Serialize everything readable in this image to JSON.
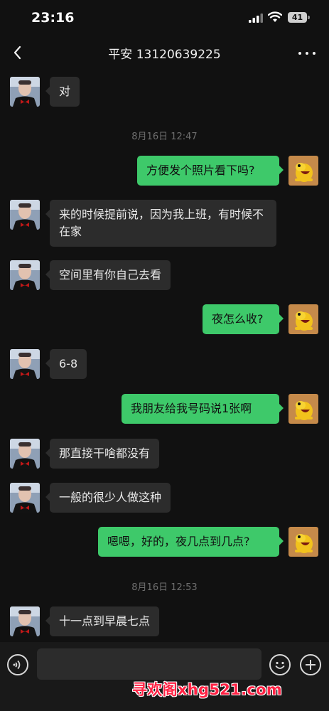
{
  "status_bar": {
    "time": "23:16",
    "battery": "41"
  },
  "header": {
    "title": "平安 13120639225"
  },
  "messages": [
    {
      "type": "in",
      "text": "对"
    },
    {
      "type": "time",
      "text": "8月16日 12:47"
    },
    {
      "type": "out",
      "text": "方便发个照片看下吗?"
    },
    {
      "type": "in",
      "text": "来的时候提前说，因为我上班，有时候不在家"
    },
    {
      "type": "in",
      "text": "空间里有你自己去看"
    },
    {
      "type": "out",
      "text": "夜怎么收?"
    },
    {
      "type": "in",
      "text": "6-8"
    },
    {
      "type": "out",
      "text": "我朋友给我号码说1张啊"
    },
    {
      "type": "in",
      "text": "那直接干啥都没有"
    },
    {
      "type": "in",
      "text": "一般的很少人做这种"
    },
    {
      "type": "out",
      "text": "嗯嗯，好的，夜几点到几点?"
    },
    {
      "type": "time",
      "text": "8月16日 12:53"
    },
    {
      "type": "in",
      "text": "十一点到早晨七点"
    }
  ],
  "watermark": "寻欢阁xhg521.com",
  "icons": {
    "back": "chevron-left-icon",
    "more": "more-dots-icon",
    "voice": "voice-icon",
    "emoji": "emoji-icon",
    "plus": "plus-icon"
  },
  "colors": {
    "outgoing_bubble": "#3ec96a",
    "incoming_bubble": "#2c2c2c",
    "background": "#111111"
  }
}
